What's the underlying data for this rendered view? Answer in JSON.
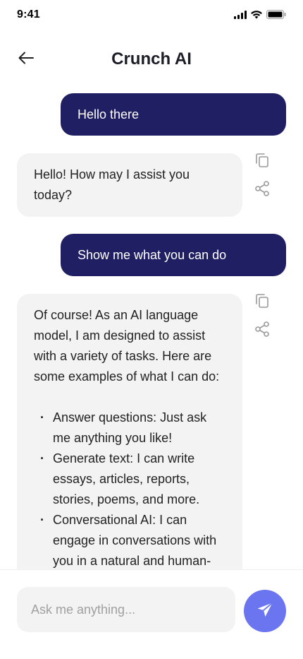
{
  "status_bar": {
    "time": "9:41",
    "icons": [
      "cellular-signal-icon",
      "wifi-icon",
      "battery-icon"
    ]
  },
  "header": {
    "title": "Crunch AI",
    "back_icon": "arrow-left-icon"
  },
  "messages": [
    {
      "role": "user",
      "text": "Hello there"
    },
    {
      "role": "assistant",
      "text": "Hello! How may I assist you today?",
      "actions": [
        "copy-icon",
        "share-icon"
      ]
    },
    {
      "role": "user",
      "text": "Show me what you can do"
    },
    {
      "role": "assistant",
      "intro": "Of course! As an AI language model, I am designed to assist with a variety of tasks. Here are some examples of what I can do:",
      "items": [
        "Answer questions: Just ask me anything you like!",
        "Generate text: I can write essays, articles, reports, stories, poems, and more.",
        "Conversational AI: I can engage in conversations with you in a natural and human-"
      ],
      "actions": [
        "copy-icon",
        "share-icon"
      ]
    }
  ],
  "composer": {
    "placeholder": "Ask me anything...",
    "send_icon": "send-icon"
  },
  "colors": {
    "user_bubble": "#201f63",
    "assistant_bubble": "#f3f3f3",
    "send_button": "#6b75f0",
    "input_background": "#f3f3f3"
  }
}
